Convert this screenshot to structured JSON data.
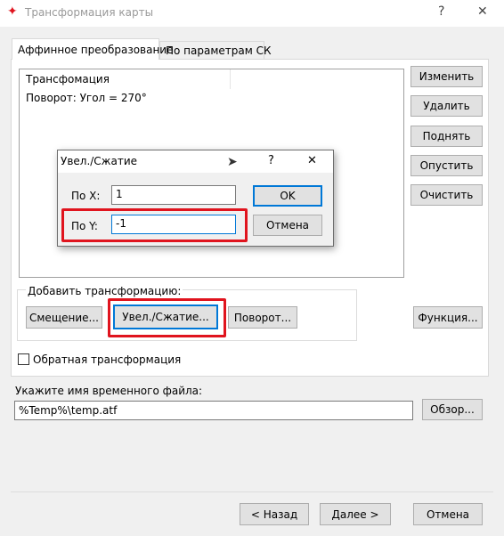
{
  "window": {
    "title": "Трансформация карты",
    "help_glyph": "?",
    "close_glyph": "✕",
    "app_icon": "red-star-icon"
  },
  "tabs": [
    {
      "label": "Аффинное преобразование",
      "active": true
    },
    {
      "label": "По параметрам СК",
      "active": false
    }
  ],
  "transform_list": {
    "header": "Трансфомация",
    "items": [
      "Поворот: Угол = 270°"
    ]
  },
  "side_buttons": {
    "change": "Изменить",
    "delete": "Удалить",
    "up": "Поднять",
    "down": "Опустить",
    "clear": "Очистить",
    "function": "Функция..."
  },
  "add_group": {
    "label": "Добавить трансформацию:",
    "shift": "Смещение...",
    "scale": "Увел./Сжатие...",
    "rotate": "Поворот..."
  },
  "inverse": {
    "label": "Обратная трансформация",
    "checked": false
  },
  "temp_file": {
    "label": "Укажите имя временного файла:",
    "value": "%Temp%\\temp.atf",
    "browse": "Обзор..."
  },
  "footer": {
    "back": "< Назад",
    "next": "Далее >",
    "cancel": "Отмена"
  },
  "dialog": {
    "title": "Увел./Сжатие",
    "help_glyph": "?",
    "close_glyph": "✕",
    "x_label": "По X:",
    "x_value": "1",
    "y_label": "По Y:",
    "y_value": "-1",
    "ok": "OK",
    "cancel": "Отмена"
  },
  "colors": {
    "highlight_red": "#e0141e",
    "accent_blue": "#0078d7",
    "background": "#f0f0f0"
  }
}
